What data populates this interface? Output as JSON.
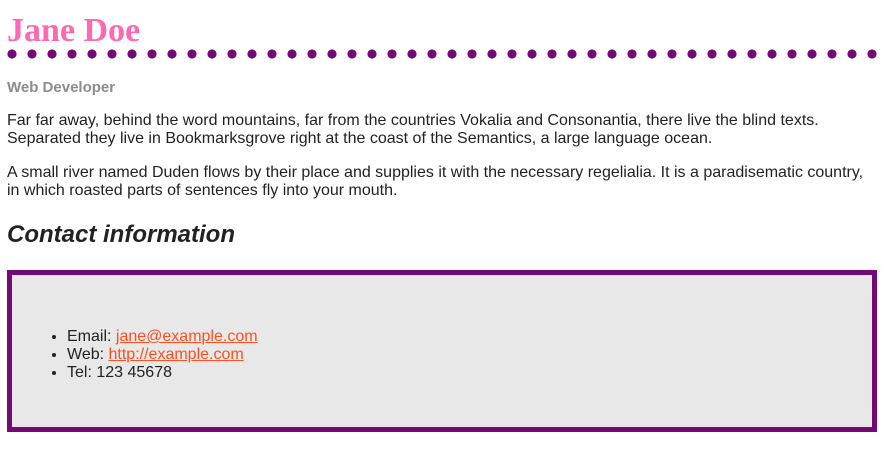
{
  "profile": {
    "name": "Jane Doe",
    "title": "Web Developer"
  },
  "bio": {
    "paragraph_1": "Far far away, behind the word mountains, far from the countries Vokalia and Consonantia, there live the blind texts. Separated they live in Bookmarksgrove right at the coast of the Semantics, a large language ocean.",
    "paragraph_2": "A small river named Duden flows by their place and supplies it with the necessary regelialia. It is a paradisematic country, in which roasted parts of sentences fly into your mouth."
  },
  "contact": {
    "heading": "Contact information",
    "items": [
      {
        "label": "Email:",
        "value": "jane@example.com",
        "href": "mailto:jane@example.com"
      },
      {
        "label": "Web:",
        "value": "http://example.com",
        "href": "http://example.com"
      },
      {
        "label": "Tel:",
        "value": "123 45678"
      }
    ]
  },
  "colors": {
    "name": "#ff69b4",
    "accent_purple": "#730a73",
    "link": "#ff4f1f",
    "box_background": "#e9e8e8",
    "subtitle_gray": "#8c8c8c"
  }
}
